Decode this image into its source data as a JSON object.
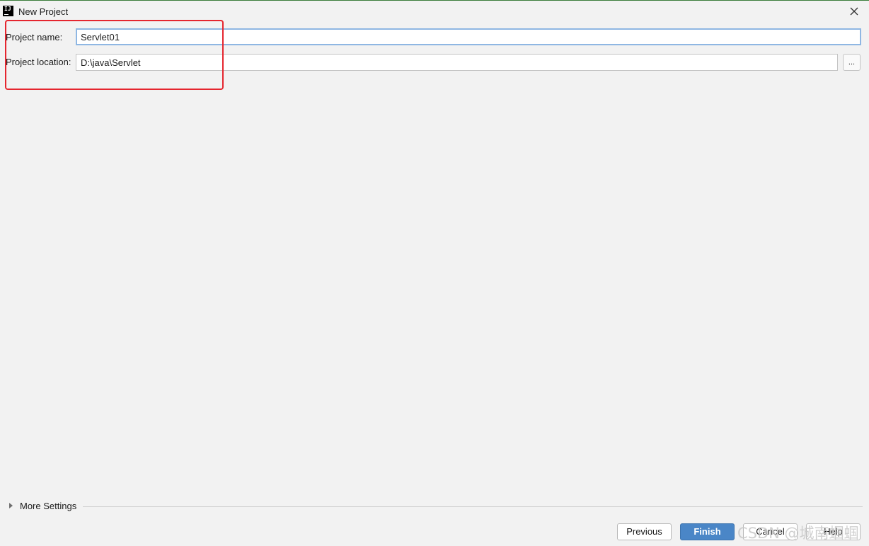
{
  "window": {
    "title": "New Project",
    "app_icon_text": "IJ"
  },
  "form": {
    "project_name_label": "Project name:",
    "project_name_value": "Servlet01",
    "project_location_label": "Project location:",
    "project_location_value": "D:\\java\\Servlet",
    "browse_label": "..."
  },
  "more_settings": {
    "label": "More Settings"
  },
  "buttons": {
    "previous": "Previous",
    "finish": "Finish",
    "cancel": "Cancel",
    "help": "Help"
  },
  "watermark": {
    "text": "CSDN @城南蝈蝈"
  },
  "colors": {
    "accent": "#4a86c7",
    "highlight": "#e5262f",
    "focus_border": "#8fb7e3"
  },
  "icons": {
    "app": "intellij-idea-icon",
    "close": "close-icon",
    "expand": "triangle-right-icon"
  }
}
